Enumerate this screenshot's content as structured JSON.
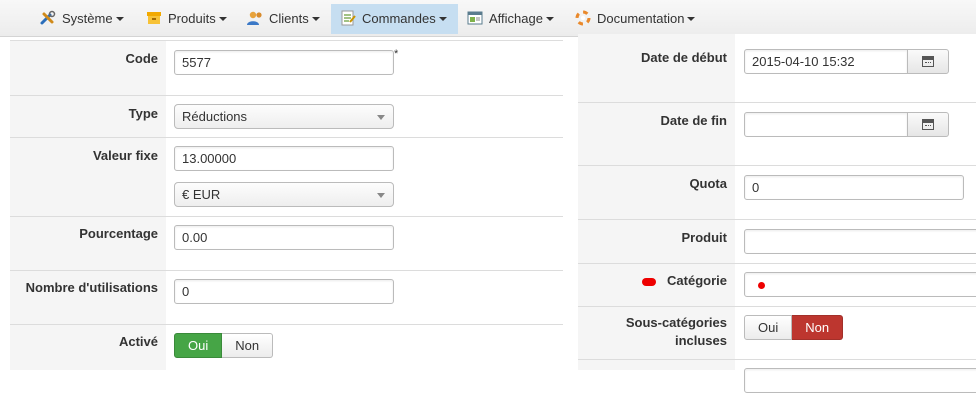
{
  "menubar": {
    "items": [
      {
        "label": "Système",
        "icon": "tools-icon",
        "active": false
      },
      {
        "label": "Produits",
        "icon": "box-icon",
        "active": false
      },
      {
        "label": "Clients",
        "icon": "users-icon",
        "active": false
      },
      {
        "label": "Commandes",
        "icon": "orders-icon",
        "active": true
      },
      {
        "label": "Affichage",
        "icon": "display-icon",
        "active": false
      },
      {
        "label": "Documentation",
        "icon": "lifebuoy-icon",
        "active": false
      }
    ],
    "active_color": "#c6def1"
  },
  "form_left": {
    "code": {
      "label": "Code",
      "value": "5577",
      "required_mark": "*"
    },
    "type": {
      "label": "Type",
      "selected": "Réductions"
    },
    "valeur_fixe": {
      "label": "Valeur fixe",
      "value": "13.00000",
      "currency": "€ EUR"
    },
    "pourcentage": {
      "label": "Pourcentage",
      "value": "0.00"
    },
    "nombre_utilisations": {
      "label": "Nombre d'utilisations",
      "value": "0"
    },
    "active": {
      "label": "Activé",
      "yes": "Oui",
      "no": "Non",
      "selected": "Oui"
    }
  },
  "form_right": {
    "date_debut": {
      "label": "Date de début",
      "value": "2015-04-10 15:32"
    },
    "date_fin": {
      "label": "Date de fin",
      "value": ""
    },
    "quota": {
      "label": "Quota",
      "value": "0"
    },
    "produit": {
      "label": "Produit",
      "value": ""
    },
    "categorie": {
      "label": "Catégorie"
    },
    "sous_categories": {
      "label_line1": "Sous-catégories",
      "label_line2": "incluses",
      "yes": "Oui",
      "no": "Non",
      "selected": "Non"
    }
  },
  "colors": {
    "green": "#46a546",
    "red": "#bd362f",
    "required_marker": "#ee0000"
  }
}
